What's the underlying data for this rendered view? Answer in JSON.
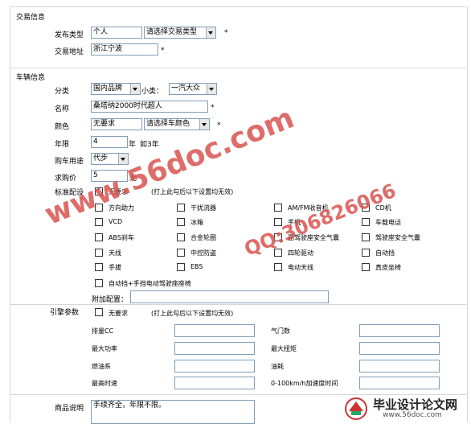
{
  "section_trade": "交易信息",
  "publish_type": {
    "label": "发布类型",
    "value": "个人",
    "select": "请选择交易类型",
    "star": "*"
  },
  "trade_address": {
    "label": "交易地址",
    "value": "浙江宁波",
    "star": "*"
  },
  "section_vehicle": "车辆信息",
  "category": {
    "label": "分类",
    "select": "国内品牌",
    "sub_label": "小类：",
    "sub_select": "一汽大众"
  },
  "name": {
    "label": "名称",
    "value": "桑塔纳2000时代超人",
    "star": "*"
  },
  "color": {
    "label": "颜色",
    "value": "无要求",
    "select": "请选择车颜色",
    "star": "*"
  },
  "age": {
    "label": "年限",
    "value": "4",
    "unit": "年",
    "note": "如3年"
  },
  "usage": {
    "label": "购车用途",
    "select": "代步"
  },
  "price": {
    "label": "求购价",
    "value": "5",
    "unit": "元"
  },
  "standard": {
    "label": "标准配设",
    "no_req": "无要求",
    "no_req_note": "(打上此勾后以下设置均无效)",
    "options": [
      [
        "方向助力",
        "干扰流器",
        "AM/FM收音机",
        "CD机"
      ],
      [
        "VCD",
        "冰箱",
        "手机",
        "车载电话"
      ],
      [
        "ABS刹车",
        "合金轮圈",
        "副驾驶座安全气囊",
        "驾驶座安全气囊"
      ],
      [
        "天线",
        "中控防盗",
        "四轮驱动",
        "自动挡"
      ],
      [
        "手拔",
        "EBS",
        "电动天线",
        "真皮坐椅"
      ]
    ],
    "wide_option": "自动挡+手挡电动驾驶座座椅",
    "extra_label": "附加配置："
  },
  "engine": {
    "label": "引擎参数",
    "no_req": "无要求",
    "no_req_note": "(打上此勾后以下设置均无效)",
    "rows": [
      [
        "排量CC",
        "气门数"
      ],
      [
        "最大功率",
        "最大扭矩"
      ],
      [
        "燃油系",
        "油耗"
      ],
      [
        "最高时速",
        "0-100km/h加速度时间"
      ]
    ]
  },
  "description": {
    "label": "商品说明",
    "value": "手续齐全，年限不限。"
  },
  "watermark": {
    "site": "www.56doc.com",
    "qq": "QQ:306826066"
  },
  "logo": {
    "title": "毕业设计论文网",
    "url": "www.56doc.com"
  }
}
